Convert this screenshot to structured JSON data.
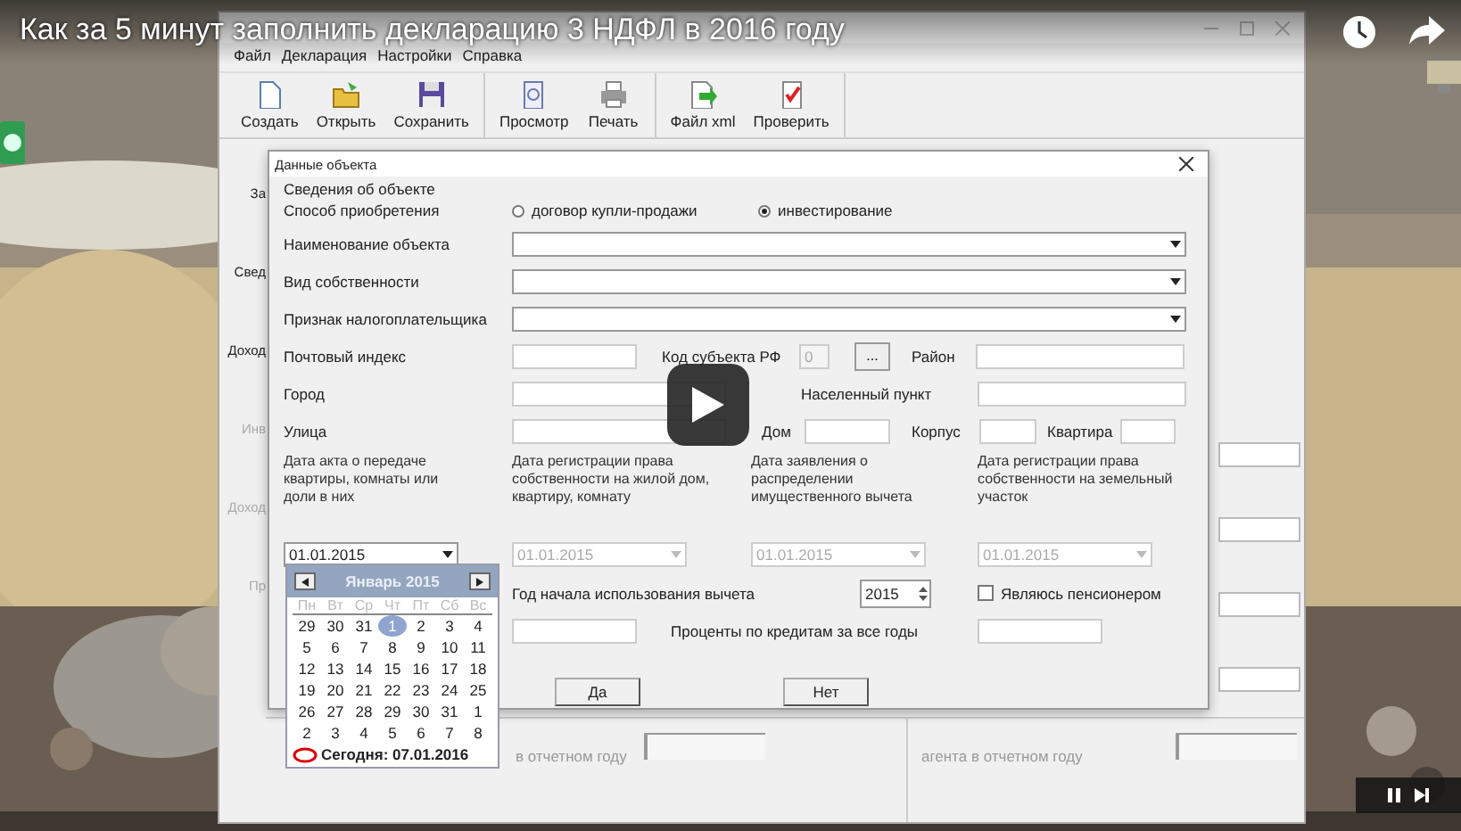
{
  "video": {
    "title": "Как за 5 минут заполнить декларацию 3 НДФЛ в 2016 году"
  },
  "app": {
    "menu": [
      "Файл",
      "Декларация",
      "Настройки",
      "Справка"
    ],
    "toolbar": [
      [
        "Создать",
        "Открыть",
        "Сохранить"
      ],
      [
        "Просмотр",
        "Печать"
      ],
      [
        "Файл xml",
        "Проверить"
      ]
    ],
    "side_labels": [
      {
        "text": "За",
        "disabled": false
      },
      {
        "text": "Свед",
        "disabled": false
      },
      {
        "text": "Доход",
        "disabled": false
      },
      {
        "text": "Инв",
        "disabled": true
      },
      {
        "text": "Доход",
        "disabled": true
      },
      {
        "text": "Пр",
        "disabled": true
      }
    ],
    "bottom_labels": [
      "в отчетном году",
      "агента в отчетном году"
    ]
  },
  "dialog": {
    "title": "Данные объекта",
    "group": "Сведения об объекте",
    "acquisition": {
      "label": "Способ приобретения",
      "options": [
        {
          "label": "договор купли-продажи",
          "selected": false
        },
        {
          "label": "инвестирование",
          "selected": true
        }
      ]
    },
    "combos": [
      {
        "label": "Наименование объекта"
      },
      {
        "label": "Вид собственности"
      },
      {
        "label": "Признак налогоплательщика"
      }
    ],
    "postal": {
      "label": "Почтовый индекс",
      "region_code_label": "Код субъекта РФ",
      "region_code": "0",
      "browse": "...",
      "district": "Район"
    },
    "city": {
      "label": "Город",
      "locality": "Населенный пункт"
    },
    "street": {
      "label": "Улица",
      "house": "Дом",
      "building": "Корпус",
      "flat": "Квартира"
    },
    "dates": [
      {
        "label": "Дата акта о передаче квартиры, комнаты или доли в них",
        "value": "01.01.2015",
        "disabled": false
      },
      {
        "label": "Дата регистрации права собственности на жилой дом, квартиру, комнату",
        "value": "01.01.2015",
        "disabled": true
      },
      {
        "label": "Дата заявления о распределении имущественного вычета",
        "value": "01.01.2015",
        "disabled": true
      },
      {
        "label": "Дата регистрации права собственности на земельный участок",
        "value": "01.01.2015",
        "disabled": true
      }
    ],
    "year": {
      "label": "Год начала использования вычета",
      "value": "2015"
    },
    "pensioner": {
      "label": "Являюсь пенсионером",
      "checked": false
    },
    "interest": {
      "label": "Проценты по кредитам за все годы"
    },
    "buttons": [
      "Да",
      "Нет"
    ]
  },
  "calendar": {
    "month": "Январь 2015",
    "weekdays": [
      "Пн",
      "Вт",
      "Ср",
      "Чт",
      "Пт",
      "Сб",
      "Вс"
    ],
    "weeks": [
      [
        {
          "d": "29",
          "selected": false
        },
        {
          "d": "30",
          "selected": false
        },
        {
          "d": "31",
          "selected": false
        },
        {
          "d": "1",
          "selected": true
        },
        {
          "d": "2",
          "selected": false
        },
        {
          "d": "3",
          "selected": false
        },
        {
          "d": "4",
          "selected": false
        }
      ],
      [
        {
          "d": "5",
          "selected": false
        },
        {
          "d": "6",
          "selected": false
        },
        {
          "d": "7",
          "selected": false
        },
        {
          "d": "8",
          "selected": false
        },
        {
          "d": "9",
          "selected": false
        },
        {
          "d": "10",
          "selected": false
        },
        {
          "d": "11",
          "selected": false
        }
      ],
      [
        {
          "d": "12",
          "selected": false
        },
        {
          "d": "13",
          "selected": false
        },
        {
          "d": "14",
          "selected": false
        },
        {
          "d": "15",
          "selected": false
        },
        {
          "d": "16",
          "selected": false
        },
        {
          "d": "17",
          "selected": false
        },
        {
          "d": "18",
          "selected": false
        }
      ],
      [
        {
          "d": "19",
          "selected": false
        },
        {
          "d": "20",
          "selected": false
        },
        {
          "d": "21",
          "selected": false
        },
        {
          "d": "22",
          "selected": false
        },
        {
          "d": "23",
          "selected": false
        },
        {
          "d": "24",
          "selected": false
        },
        {
          "d": "25",
          "selected": false
        }
      ],
      [
        {
          "d": "26",
          "selected": false
        },
        {
          "d": "27",
          "selected": false
        },
        {
          "d": "28",
          "selected": false
        },
        {
          "d": "29",
          "selected": false
        },
        {
          "d": "30",
          "selected": false
        },
        {
          "d": "31",
          "selected": false
        },
        {
          "d": "1",
          "selected": false
        }
      ],
      [
        {
          "d": "2",
          "selected": false
        },
        {
          "d": "3",
          "selected": false
        },
        {
          "d": "4",
          "selected": false
        },
        {
          "d": "5",
          "selected": false
        },
        {
          "d": "6",
          "selected": false
        },
        {
          "d": "7",
          "selected": false
        },
        {
          "d": "8",
          "selected": false
        }
      ]
    ],
    "today": "Сегодня: 07.01.2016"
  }
}
